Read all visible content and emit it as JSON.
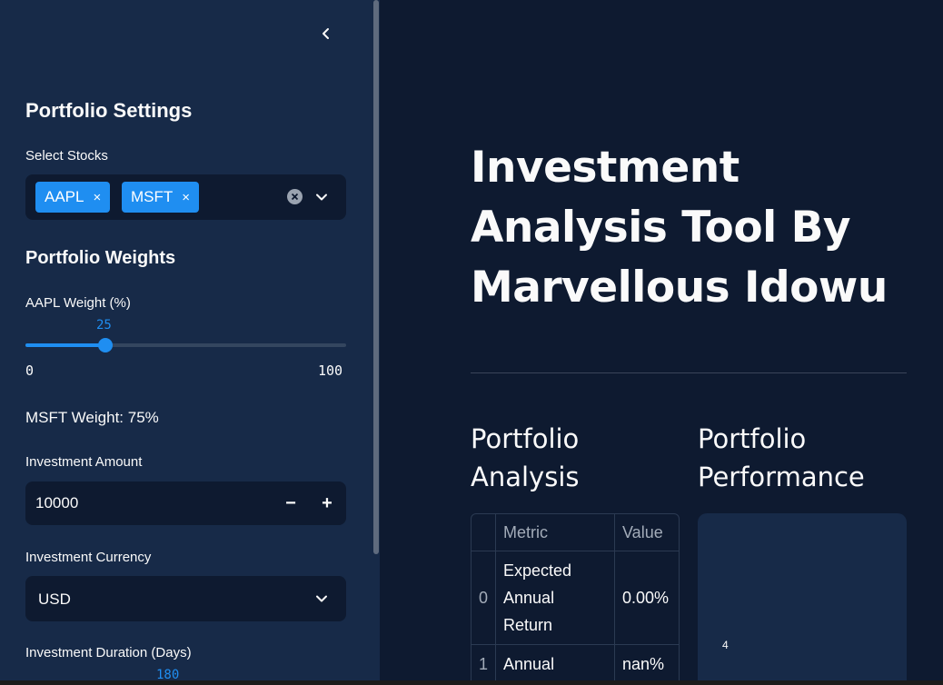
{
  "sidebar": {
    "heading": "Portfolio Settings",
    "select_stocks": {
      "label": "Select Stocks",
      "selected": [
        "AAPL",
        "MSFT"
      ],
      "chip_remove": "×"
    },
    "weights": {
      "heading": "Portfolio Weights",
      "aapl_label": "AAPL Weight (%)",
      "aapl_value": "25",
      "aapl_fraction": 0.25,
      "min": "0",
      "max": "100",
      "msft_text": "MSFT Weight: 75%"
    },
    "investment_amount": {
      "label": "Investment Amount",
      "value": "10000",
      "minus": "−",
      "plus": "+"
    },
    "currency": {
      "label": "Investment Currency",
      "value": "USD"
    },
    "duration": {
      "label": "Investment Duration (Days)",
      "value": "180"
    }
  },
  "main": {
    "title": "Investment Analysis Tool By Marvellous Idowu",
    "analysis": {
      "heading": "Portfolio Analysis",
      "columns": [
        "",
        "Metric",
        "Value"
      ],
      "rows": [
        {
          "index": "0",
          "metric": "Expected Annual Return",
          "value": "0.00%"
        },
        {
          "index": "1",
          "metric": "Annual",
          "value": "nan%"
        }
      ]
    },
    "performance": {
      "heading": "Portfolio Performance",
      "tick_label": "4"
    }
  },
  "colors": {
    "accent": "#1f8ef1",
    "sidebar_bg": "#172a48",
    "main_bg": "#0e1a30"
  }
}
